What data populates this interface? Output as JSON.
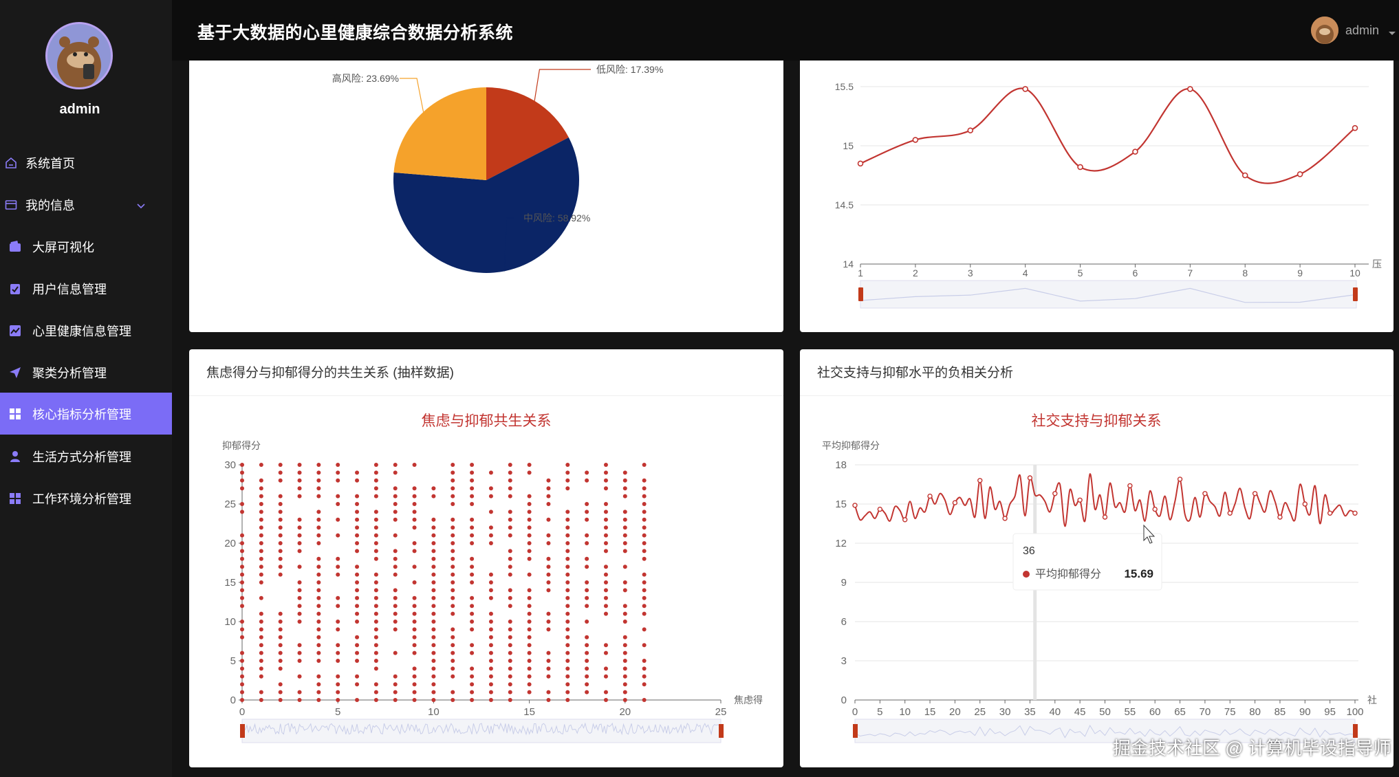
{
  "header": {
    "title": "基于大数据的心里健康综合数据分析系统",
    "user": "admin"
  },
  "sidebar": {
    "user": "admin",
    "items": [
      {
        "label": "系统首页",
        "icon": "home-icon"
      },
      {
        "label": "我的信息",
        "icon": "card-icon"
      },
      {
        "label": "大屏可视化",
        "icon": "wallet-icon"
      },
      {
        "label": "用户信息管理",
        "icon": "clipboard-icon"
      },
      {
        "label": "心里健康信息管理",
        "icon": "chart-icon"
      },
      {
        "label": "聚类分析管理",
        "icon": "send-icon"
      },
      {
        "label": "核心指标分析管理",
        "icon": "grid-icon",
        "active": true
      },
      {
        "label": "生活方式分析管理",
        "icon": "user-icon"
      },
      {
        "label": "工作环境分析管理",
        "icon": "grid-icon"
      }
    ]
  },
  "colors": {
    "accent": "#7b6cf6",
    "series_red": "#c23531",
    "navy": "#0b2566",
    "orange": "#f5a22b",
    "red": "#c23a1a"
  },
  "watermark": "掘金技术社区 @ 计算机毕设指导师",
  "chart_data": [
    {
      "type": "pie",
      "slices": [
        {
          "name": "低风险",
          "value": 17.39,
          "label": "低风险: 17.39%"
        },
        {
          "name": "中风险",
          "value": 58.92,
          "label": "中风险: 58.92%"
        },
        {
          "name": "高风险",
          "value": 23.69,
          "label": "高风险: 23.69%"
        }
      ]
    },
    {
      "type": "line",
      "x": [
        1,
        2,
        3,
        4,
        5,
        6,
        7,
        8,
        9,
        10
      ],
      "values": [
        14.85,
        15.05,
        15.13,
        15.48,
        14.82,
        14.95,
        15.48,
        14.75,
        14.76,
        15.15
      ],
      "ylim": [
        14,
        15.5
      ],
      "yticks": [
        "14",
        "14.5",
        "15",
        "15.5"
      ],
      "xlabel": "压"
    },
    {
      "type": "scatter",
      "card_title": "焦虑得分与抑郁得分的共生关系 (抽样数据)",
      "title": "焦虑与抑郁共生关系",
      "ylabel": "抑郁得分",
      "xlabel": "焦虑得",
      "xlim": [
        0,
        25
      ],
      "ylim": [
        0,
        30
      ],
      "xticks": [
        "0",
        "5",
        "10",
        "15",
        "20",
        "25"
      ],
      "yticks": [
        "0",
        "5",
        "10",
        "15",
        "20",
        "25",
        "30"
      ],
      "x_values": [
        0,
        1,
        2,
        3,
        4,
        5,
        6,
        7,
        8,
        9,
        10,
        11,
        12,
        13,
        14,
        15,
        16,
        17,
        18,
        19,
        20,
        21
      ],
      "y_values": [
        0,
        1,
        2,
        3,
        4,
        5,
        6,
        7,
        8,
        9,
        10,
        11,
        12,
        13,
        14,
        15,
        16,
        17,
        18,
        19,
        20,
        21,
        22,
        23,
        24,
        25,
        26,
        27,
        28,
        29,
        30
      ]
    },
    {
      "type": "line",
      "card_title": "社交支持与抑郁水平的负相关分析",
      "title": "社交支持与抑郁关系",
      "ylabel": "平均抑郁得分",
      "xlabel": "社",
      "xlim": [
        0,
        100
      ],
      "ylim": [
        0,
        18
      ],
      "xticks": [
        "0",
        "5",
        "10",
        "15",
        "20",
        "25",
        "30",
        "35",
        "40",
        "45",
        "50",
        "55",
        "60",
        "65",
        "70",
        "75",
        "80",
        "85",
        "90",
        "95",
        "100"
      ],
      "yticks": [
        "0",
        "3",
        "6",
        "9",
        "12",
        "15",
        "18"
      ],
      "values": [
        14.9,
        13.8,
        14.1,
        14.4,
        13.9,
        14.6,
        14.3,
        13.7,
        14.8,
        14.5,
        13.8,
        15.2,
        13.9,
        14.7,
        14.4,
        15.6,
        15.0,
        15.8,
        15.3,
        14.2,
        15.1,
        15.5,
        14.9,
        15.4,
        14.0,
        16.8,
        13.9,
        16.3,
        14.6,
        15.2,
        13.9,
        15.0,
        15.6,
        17.2,
        14.1,
        17.0,
        15.7,
        15.69,
        15.2,
        14.4,
        15.8,
        16.5,
        13.3,
        16.1,
        14.9,
        15.3,
        13.7,
        17.3,
        14.6,
        15.7,
        14.0,
        16.6,
        14.8,
        15.1,
        14.4,
        16.4,
        14.5,
        15.3,
        13.7,
        16.0,
        14.6,
        14.1,
        15.6,
        13.8,
        15.2,
        16.9,
        14.2,
        13.8,
        15.5,
        14.0,
        15.8,
        15.2,
        14.8,
        14.1,
        15.9,
        14.3,
        15.0,
        16.2,
        14.7,
        13.9,
        15.8,
        15.1,
        14.4,
        16.0,
        15.2,
        14.0,
        15.1,
        14.4,
        13.8,
        16.5,
        15.0,
        14.2,
        16.4,
        13.5,
        15.7,
        14.3,
        14.6,
        14.9,
        14.1,
        14.5,
        14.3
      ],
      "tooltip": {
        "x": "36",
        "series": "平均抑郁得分",
        "value": "15.69"
      }
    }
  ]
}
